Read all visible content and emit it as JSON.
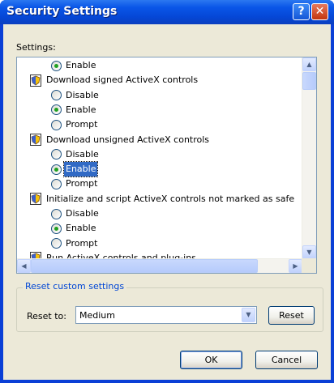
{
  "window": {
    "title": "Security Settings",
    "help_glyph": "?",
    "close_glyph": "✕"
  },
  "settings_label": "Settings:",
  "settings": [
    {
      "kind": "radio",
      "label": "Enable",
      "checked": true
    },
    {
      "kind": "header",
      "label": "Download signed ActiveX controls",
      "icon": "settings-shield-icon"
    },
    {
      "kind": "radio",
      "label": "Disable",
      "checked": false
    },
    {
      "kind": "radio",
      "label": "Enable",
      "checked": true
    },
    {
      "kind": "radio",
      "label": "Prompt",
      "checked": false
    },
    {
      "kind": "header",
      "label": "Download unsigned ActiveX controls",
      "icon": "settings-shield-icon"
    },
    {
      "kind": "radio",
      "label": "Disable",
      "checked": false
    },
    {
      "kind": "radio",
      "label": "Enable",
      "checked": true,
      "selected": true
    },
    {
      "kind": "radio",
      "label": "Prompt",
      "checked": false
    },
    {
      "kind": "header",
      "label": "Initialize and script ActiveX controls not marked as safe",
      "icon": "settings-shield-icon"
    },
    {
      "kind": "radio",
      "label": "Disable",
      "checked": false
    },
    {
      "kind": "radio",
      "label": "Enable",
      "checked": true
    },
    {
      "kind": "radio",
      "label": "Prompt",
      "checked": false
    },
    {
      "kind": "header",
      "label": "Run ActiveX controls and plug-ins",
      "icon": "settings-shield-icon"
    }
  ],
  "reset_group": {
    "title": "Reset custom settings",
    "reset_to_label": "Reset to:",
    "reset_to_value": "Medium",
    "reset_button": "Reset"
  },
  "buttons": {
    "ok": "OK",
    "cancel": "Cancel"
  },
  "scrollbar_glyphs": {
    "up": "▲",
    "down": "▼",
    "left": "◀",
    "right": "▶"
  },
  "colors": {
    "title_bar": "#0a56e8",
    "selection": "#316ac5",
    "group_title": "#0046d5"
  }
}
